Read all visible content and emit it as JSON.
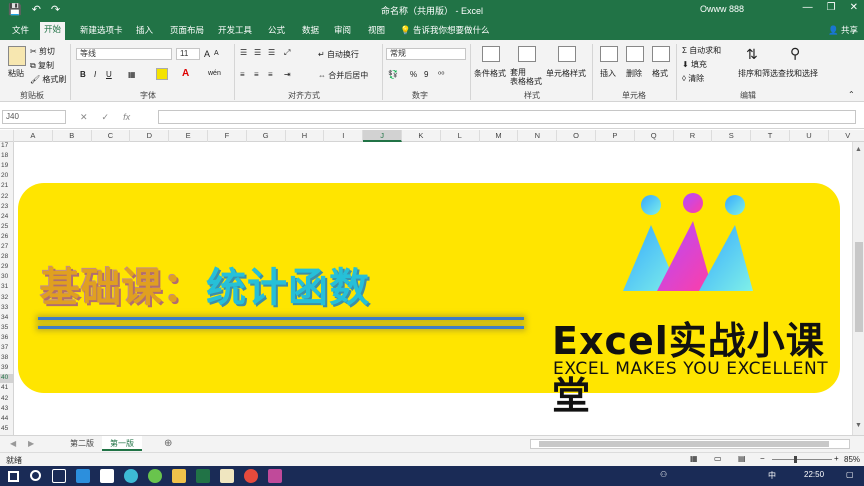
{
  "window": {
    "title": "命名称（共用版） - Excel",
    "user": "Owww 888",
    "min": "—",
    "restore": "❐",
    "close": "✕",
    "qat_save": "💾",
    "qat_undo": "↶",
    "qat_redo": "↷"
  },
  "tabs": [
    "文件",
    "开始",
    "新建选项卡",
    "插入",
    "页面布局",
    "开发工具",
    "公式",
    "数据",
    "审阅",
    "视图"
  ],
  "active_tab": "开始",
  "tellme": "告诉我你想要做什么",
  "share": "共享",
  "ribbon": {
    "clipboard": {
      "paste": "粘贴",
      "cut": "剪切",
      "copy": "复制",
      "painter": "格式刷",
      "label": "剪贴板"
    },
    "font": {
      "name": "等线",
      "size": "11",
      "label": "字体",
      "bold": "B",
      "italic": "I",
      "underline": "U",
      "grow": "A",
      "shrink": "A",
      "wen": "wén"
    },
    "alignment": {
      "wrap": "自动换行",
      "merge": "合并后居中",
      "label": "对齐方式"
    },
    "number": {
      "format": "常规",
      "label": "数字",
      "percent": "%",
      "comma": "9"
    },
    "styles": {
      "conditional": "条件格式",
      "table": "套用\n表格格式",
      "cell": "单元格样式",
      "label": "样式"
    },
    "cells": {
      "insert": "插入",
      "delete": "删除",
      "format": "格式",
      "label": "单元格"
    },
    "editing": {
      "autosum": "自动求和",
      "fill": "填充",
      "clear": "清除",
      "sort": "排序和筛选",
      "find": "查找和选择",
      "label": "编辑"
    }
  },
  "formula_bar": {
    "namebox": "J40",
    "fx": "fx",
    "value": ""
  },
  "columns": [
    "A",
    "B",
    "C",
    "D",
    "E",
    "F",
    "G",
    "H",
    "I",
    "J",
    "K",
    "L",
    "M",
    "N",
    "O",
    "P",
    "Q",
    "R",
    "S",
    "T",
    "U",
    "V"
  ],
  "selected_column": "J",
  "rows": [
    "17",
    "18",
    "19",
    "20",
    "21",
    "22",
    "23",
    "24",
    "25",
    "26",
    "27",
    "28",
    "29",
    "30",
    "31",
    "32",
    "33",
    "34",
    "35",
    "36",
    "37",
    "38",
    "39",
    "40",
    "41",
    "42",
    "43",
    "44",
    "45"
  ],
  "selected_row": "40",
  "banner": {
    "title_part1": "基础课：",
    "title_part2": "统计函数",
    "brand": "Excel实战小课堂",
    "tagline": "EXCEL MAKES YOU EXCELLENT",
    "colors": {
      "background": "#FFE500",
      "title_part1": "#E0A020",
      "title_part2": "#26C0D8",
      "lines": "#3E7EC6"
    }
  },
  "sheets": [
    "第二版",
    "第一版"
  ],
  "active_sheet": "第一版",
  "status": {
    "ready": "就绪",
    "zoom": "85%",
    "minus": "−",
    "plus": "+"
  },
  "taskbar": {
    "time": "22:50",
    "ime": "中",
    "icons": [
      "start-icon",
      "search-icon",
      "taskview-icon",
      "edge-icon",
      "music-icon",
      "chat-icon",
      "browser-icon",
      "folder-icon",
      "excel-icon",
      "notes-icon",
      "media-icon",
      "lab-icon"
    ]
  },
  "colors": {
    "excel_green": "#217346",
    "ribbon_bg": "#F3F3F3",
    "taskbar": "#1A2B56"
  }
}
